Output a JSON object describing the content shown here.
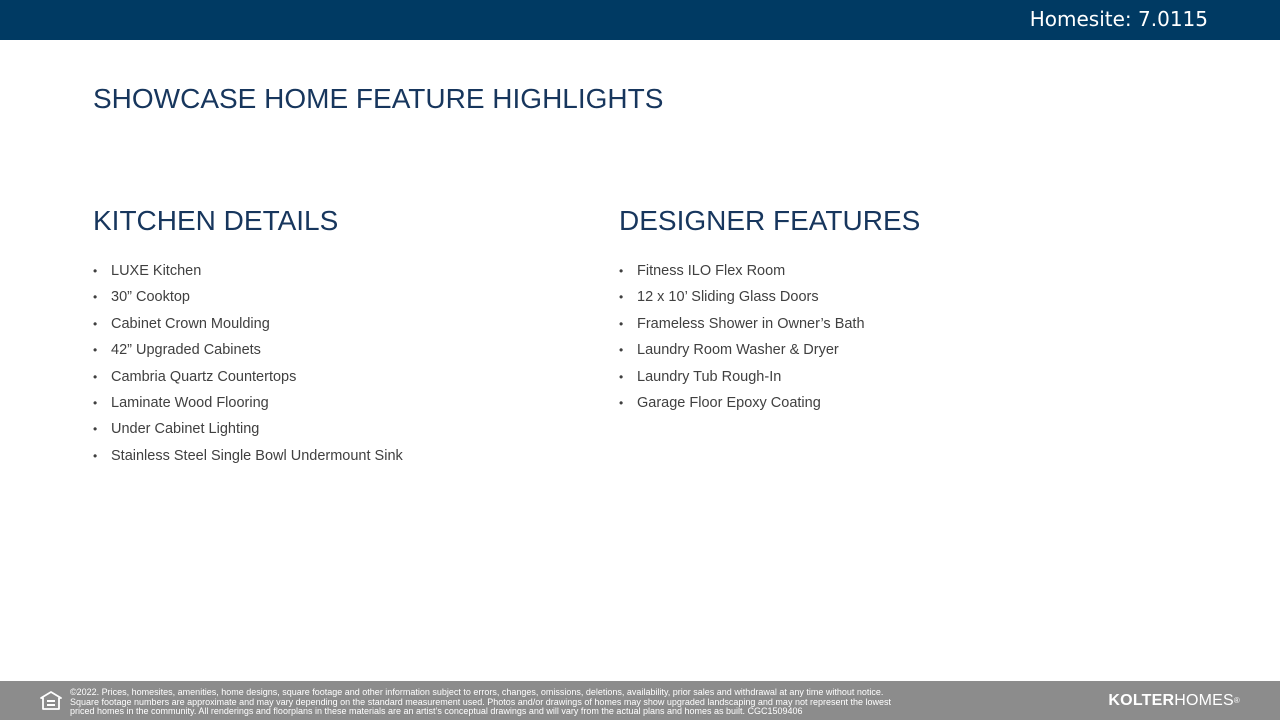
{
  "header": {
    "homesite": "Homesite: 7.0115"
  },
  "title": "SHOWCASE HOME FEATURE HIGHLIGHTS",
  "kitchen": {
    "heading": "KITCHEN DETAILS",
    "items": [
      "LUXE Kitchen",
      "30” Cooktop",
      "Cabinet Crown Moulding",
      "42” Upgraded Cabinets",
      "Cambria Quartz Countertops",
      "Laminate Wood Flooring",
      "Under Cabinet Lighting",
      "Stainless Steel Single Bowl Undermount Sink"
    ]
  },
  "designer": {
    "heading": "DESIGNER FEATURES",
    "items": [
      "Fitness ILO Flex Room",
      "12 x 10’ Sliding Glass Doors",
      "Frameless Shower in Owner’s Bath",
      "Laundry Room Washer & Dryer",
      "Laundry Tub Rough-In",
      "Garage Floor Epoxy Coating"
    ]
  },
  "bullet": "•",
  "footer": {
    "icon": "equal-housing-opportunity-icon",
    "disclaimer": "©2022. Prices, homesites, amenities, home designs, square footage and other information subject to errors, changes, omissions, deletions, availability, prior sales and withdrawal at any time without notice.\nSquare footage numbers are approximate and may vary depending on the standard measurement used. Photos and/or drawings of homes may show upgraded landscaping and may not represent the lowest\npriced homes in the community. All renderings and floorplans in these materials are an artist’s conceptual drawings and will vary from the actual plans and homes as built. CGC1509406",
    "brand_bold": "KOLTER",
    "brand_regular": "HOMES",
    "brand_mark": "®"
  },
  "colors": {
    "header_bar": "#003a63",
    "heading_text": "#17365d",
    "body_text": "#404040",
    "footer_bar": "#8c8c8c"
  }
}
